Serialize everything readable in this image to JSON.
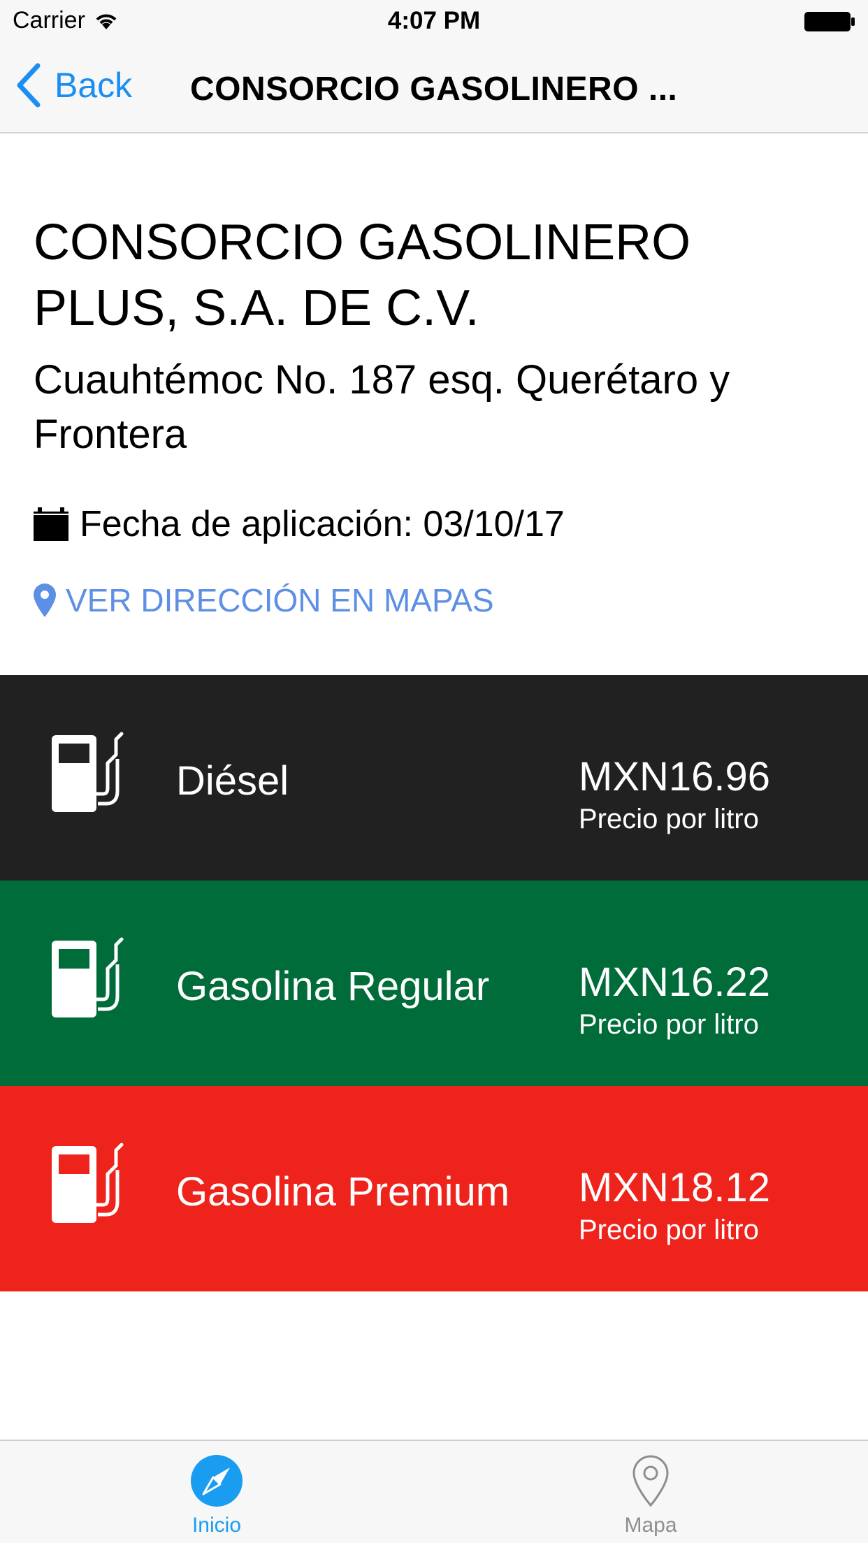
{
  "status_bar": {
    "carrier": "Carrier",
    "time": "4:07 PM"
  },
  "nav": {
    "back_label": "Back",
    "title": "CONSORCIO GASOLINERO ..."
  },
  "station": {
    "name": "CONSORCIO GASOLINERO PLUS, S.A. DE C.V.",
    "address": "Cuauhtémoc No. 187 esq. Querétaro y Frontera",
    "date_text": "Fecha de aplicación: 03/10/17",
    "map_link_label": "VER DIRECCIÓN EN MAPAS"
  },
  "fuels": [
    {
      "name": "Diésel",
      "price": "MXN16.96",
      "unit": "Precio por litro",
      "color": "#212121",
      "screen_color": "#212121"
    },
    {
      "name": "Gasolina Regular",
      "price": "MXN16.22",
      "unit": "Precio por litro",
      "color": "#006c3a",
      "screen_color": "#006c3a"
    },
    {
      "name": "Gasolina Premium",
      "price": "MXN18.12",
      "unit": "Precio por litro",
      "color": "#ee231c",
      "screen_color": "#ee231c"
    }
  ],
  "tabs": [
    {
      "label": "Inicio",
      "icon": "compass-icon",
      "active": true
    },
    {
      "label": "Mapa",
      "icon": "map-pin-icon",
      "active": false
    }
  ],
  "colors": {
    "accent": "#1a8ef1",
    "link": "#5d8fe4",
    "tab_active": "#1a9df0",
    "tab_inactive": "#8e8e8e"
  }
}
